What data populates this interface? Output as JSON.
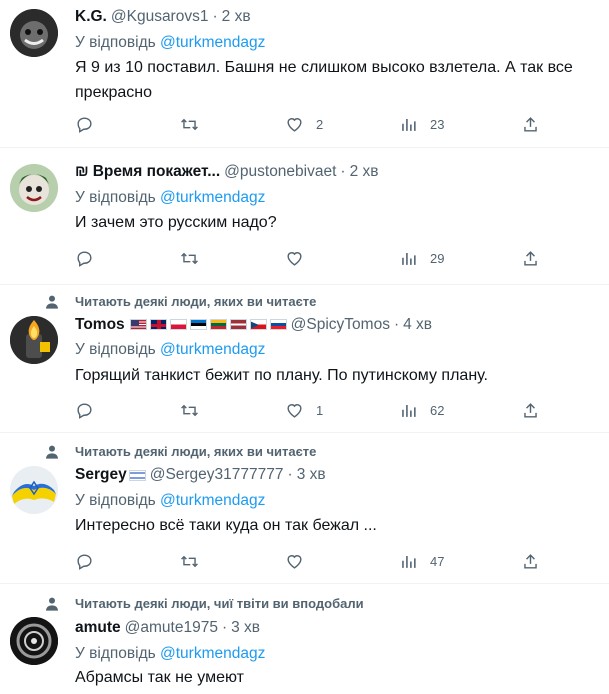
{
  "reply_prefix": "У відповідь",
  "tweets": [
    {
      "name": "K.G.",
      "handle": "@Kgusarovs1",
      "time": "2 хв",
      "mention": "@turkmendagz",
      "text": "Я 9 из 10 поставил. Башня не слишком высоко взлетела. А так все прекрасно",
      "likes": "2",
      "views": "23"
    },
    {
      "name_prefix": "₪",
      "name": "Время покажет...",
      "handle": "@pustonebivaet",
      "time": "2 хв",
      "mention": "@turkmendagz",
      "text": "И зачем это русским надо?",
      "views": "29"
    },
    {
      "social_context": "Читають деякі люди, яких ви читаєте",
      "name": "Tomos",
      "handle": "@SpicyTomos",
      "time": "4 хв",
      "mention": "@turkmendagz",
      "text": "Горящий танкист бежит по плану. По путинскому плану.",
      "likes": "1",
      "views": "62"
    },
    {
      "social_context": "Читають деякі люди, яких ви читаєте",
      "name": "Sergey",
      "handle": "@Sergey31777777",
      "time": "3 хв",
      "mention": "@turkmendagz",
      "text": "Интересно всё таки куда он так бежал ...",
      "views": "47"
    },
    {
      "social_context": "Читають деякі люди, чиї твіти ви вподобали",
      "name": "amute",
      "handle": "@amute1975",
      "time": "3 хв",
      "mention": "@turkmendagz",
      "text": "Абрамсы так не умеют"
    }
  ],
  "icons": [
    "reply-icon",
    "retweet-icon",
    "like-icon",
    "views-icon",
    "share-icon",
    "person-icon"
  ],
  "colors": {
    "link": "#1d9bf0",
    "secondary": "#536471",
    "text": "#0f1419",
    "divider": "#eff3f4"
  }
}
